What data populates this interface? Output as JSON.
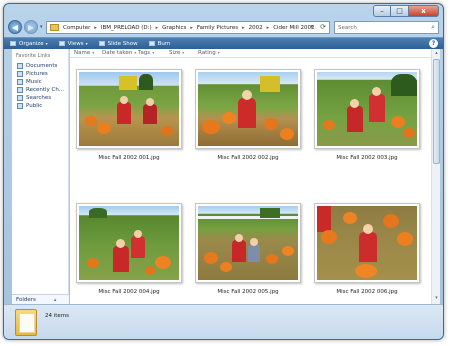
{
  "window": {
    "controls": {
      "minimize": "–",
      "maximize": "□",
      "close": "x"
    }
  },
  "nav": {
    "back_icon": "◀",
    "forward_icon": "▶",
    "recent_dropdown": "▾",
    "address": {
      "segments": [
        "Computer",
        "IBM_PRELOAD (D:)",
        "Graphics",
        "Family Pictures",
        "2002",
        "Cider Mill 2002"
      ],
      "separator": "▸",
      "dropdown": "▾",
      "refresh_icon": "⟳"
    },
    "search": {
      "placeholder": "Search",
      "icon": "⌕"
    }
  },
  "toolbar": {
    "items": [
      {
        "label": "Organize",
        "dropdown": "▾"
      },
      {
        "label": "Views",
        "dropdown": "▾"
      },
      {
        "label": "Slide Show",
        "dropdown": ""
      },
      {
        "label": "Burn",
        "dropdown": ""
      }
    ],
    "help": "?"
  },
  "sidebar": {
    "title": "Favorite Links",
    "items": [
      {
        "label": "Documents",
        "icon": "documents-icon"
      },
      {
        "label": "Pictures",
        "icon": "pictures-icon"
      },
      {
        "label": "Music",
        "icon": "music-icon"
      },
      {
        "label": "Recently Ch...",
        "icon": "recent-icon"
      },
      {
        "label": "Searches",
        "icon": "searches-icon"
      },
      {
        "label": "Public",
        "icon": "public-icon"
      }
    ],
    "folders_label": "Folders",
    "folders_chevron": "▴"
  },
  "columns": [
    {
      "label": "Name",
      "dropdown": "▾"
    },
    {
      "label": "Date taken",
      "dropdown": "▾"
    },
    {
      "label": "Tags",
      "dropdown": "▾"
    },
    {
      "label": "Size",
      "dropdown": "▾"
    },
    {
      "label": "Rating",
      "dropdown": "▾"
    }
  ],
  "files": [
    {
      "name": "Misc Fall 2002 001.jpg"
    },
    {
      "name": "Misc Fall 2002 002.jpg"
    },
    {
      "name": "Misc Fall 2002 003.jpg"
    },
    {
      "name": "Misc Fall 2002 004.jpg"
    },
    {
      "name": "Misc Fall 2002 005.jpg"
    },
    {
      "name": "Misc Fall 2002 006.jpg"
    }
  ],
  "scrollbar": {
    "up": "▴",
    "down": "▾"
  },
  "details": {
    "item_count": "24 items"
  }
}
